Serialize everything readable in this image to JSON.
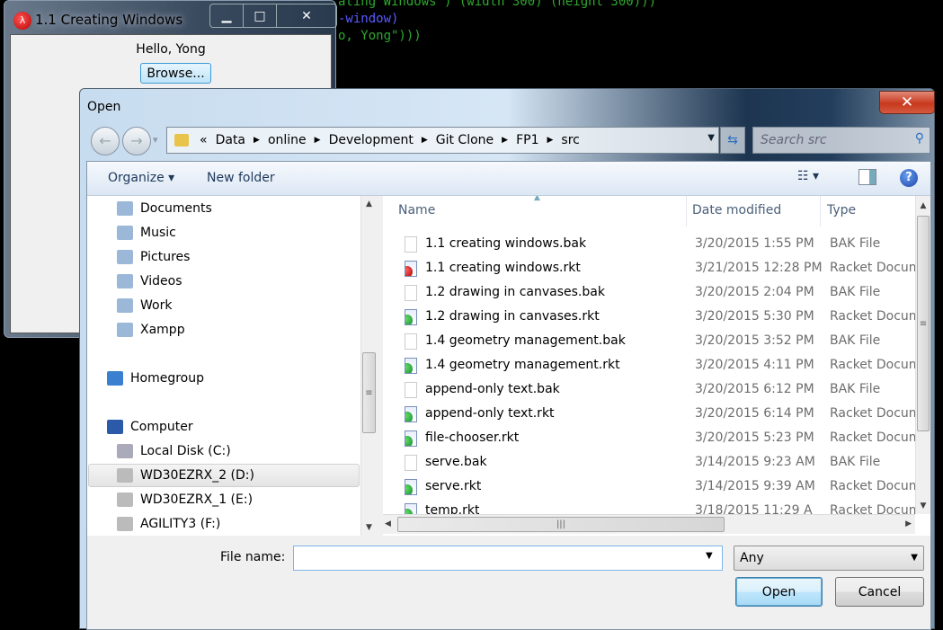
{
  "background_code": {
    "line1": "ating Windows\") (width 300) (height 300)))",
    "line2": "-window)",
    "line3": "o, Yong\")))",
    "colors": {
      "paren": "#c8401e",
      "keyword": "#5a5aff",
      "string": "#2ea82e"
    }
  },
  "app_window": {
    "title": "1.1 Creating Windows",
    "icon": "racket-logo",
    "minimize": "▁",
    "maximize": "□",
    "close": "✕",
    "message": "Hello, Yong",
    "browse_label": "Browse..."
  },
  "dialog": {
    "title": "Open",
    "close": "✕",
    "nav": {
      "back": "←",
      "forward": "→",
      "recent": "▾"
    },
    "breadcrumb": [
      "Data",
      "online",
      "Development",
      "Git Clone",
      "FP1",
      "src"
    ],
    "breadcrumb_overflow": "«",
    "search_placeholder": "Search src",
    "toolbar": {
      "organize": "Organize ▾",
      "new_folder": "New folder"
    },
    "sidebar": [
      {
        "label": "Documents",
        "icon": "documents-icon"
      },
      {
        "label": "Music",
        "icon": "music-icon"
      },
      {
        "label": "Pictures",
        "icon": "pictures-icon"
      },
      {
        "label": "Videos",
        "icon": "videos-icon"
      },
      {
        "label": "Work",
        "icon": "library-icon"
      },
      {
        "label": "Xampp",
        "icon": "library-icon"
      },
      {
        "label": "Homegroup",
        "icon": "homegroup-icon"
      },
      {
        "label": "Computer",
        "icon": "computer-icon"
      },
      {
        "label": "Local Disk (C:)",
        "icon": "system-drive-icon"
      },
      {
        "label": "WD30EZRX_2 (D:)",
        "icon": "drive-icon",
        "selected": true
      },
      {
        "label": "WD30EZRX_1 (E:)",
        "icon": "drive-icon"
      },
      {
        "label": "AGILITY3 (F:)",
        "icon": "drive-icon"
      }
    ],
    "columns": [
      "Name",
      "Date modified",
      "Type"
    ],
    "files": [
      {
        "name": "1.1 creating windows.bak",
        "date": "3/20/2015 1:55 PM",
        "type": "BAK File",
        "kind": "bak"
      },
      {
        "name": "1.1 creating windows.rkt",
        "date": "3/21/2015 12:28 PM",
        "type": "Racket Docum",
        "kind": "rkt-red"
      },
      {
        "name": "1.2 drawing in canvases.bak",
        "date": "3/20/2015 2:04 PM",
        "type": "BAK File",
        "kind": "bak"
      },
      {
        "name": "1.2 drawing in canvases.rkt",
        "date": "3/20/2015 5:30 PM",
        "type": "Racket Docum",
        "kind": "rkt"
      },
      {
        "name": "1.4 geometry management.bak",
        "date": "3/20/2015 3:52 PM",
        "type": "BAK File",
        "kind": "bak"
      },
      {
        "name": "1.4 geometry management.rkt",
        "date": "3/20/2015 4:11 PM",
        "type": "Racket Docum",
        "kind": "rkt"
      },
      {
        "name": "append-only text.bak",
        "date": "3/20/2015 6:12 PM",
        "type": "BAK File",
        "kind": "bak"
      },
      {
        "name": "append-only text.rkt",
        "date": "3/20/2015 6:14 PM",
        "type": "Racket Docum",
        "kind": "rkt"
      },
      {
        "name": "file-chooser.rkt",
        "date": "3/20/2015 5:23 PM",
        "type": "Racket Docum",
        "kind": "rkt"
      },
      {
        "name": "serve.bak",
        "date": "3/14/2015 9:23 AM",
        "type": "BAK File",
        "kind": "bak"
      },
      {
        "name": "serve.rkt",
        "date": "3/14/2015 9:39 AM",
        "type": "Racket Docum",
        "kind": "rkt"
      },
      {
        "name": "temp.rkt",
        "date": "3/18/2015 11:29 A",
        "type": "Racket Docum",
        "kind": "rkt"
      }
    ],
    "file_name_label": "File name:",
    "file_name_value": "",
    "filter_value": "Any",
    "open_label": "Open",
    "cancel_label": "Cancel"
  }
}
